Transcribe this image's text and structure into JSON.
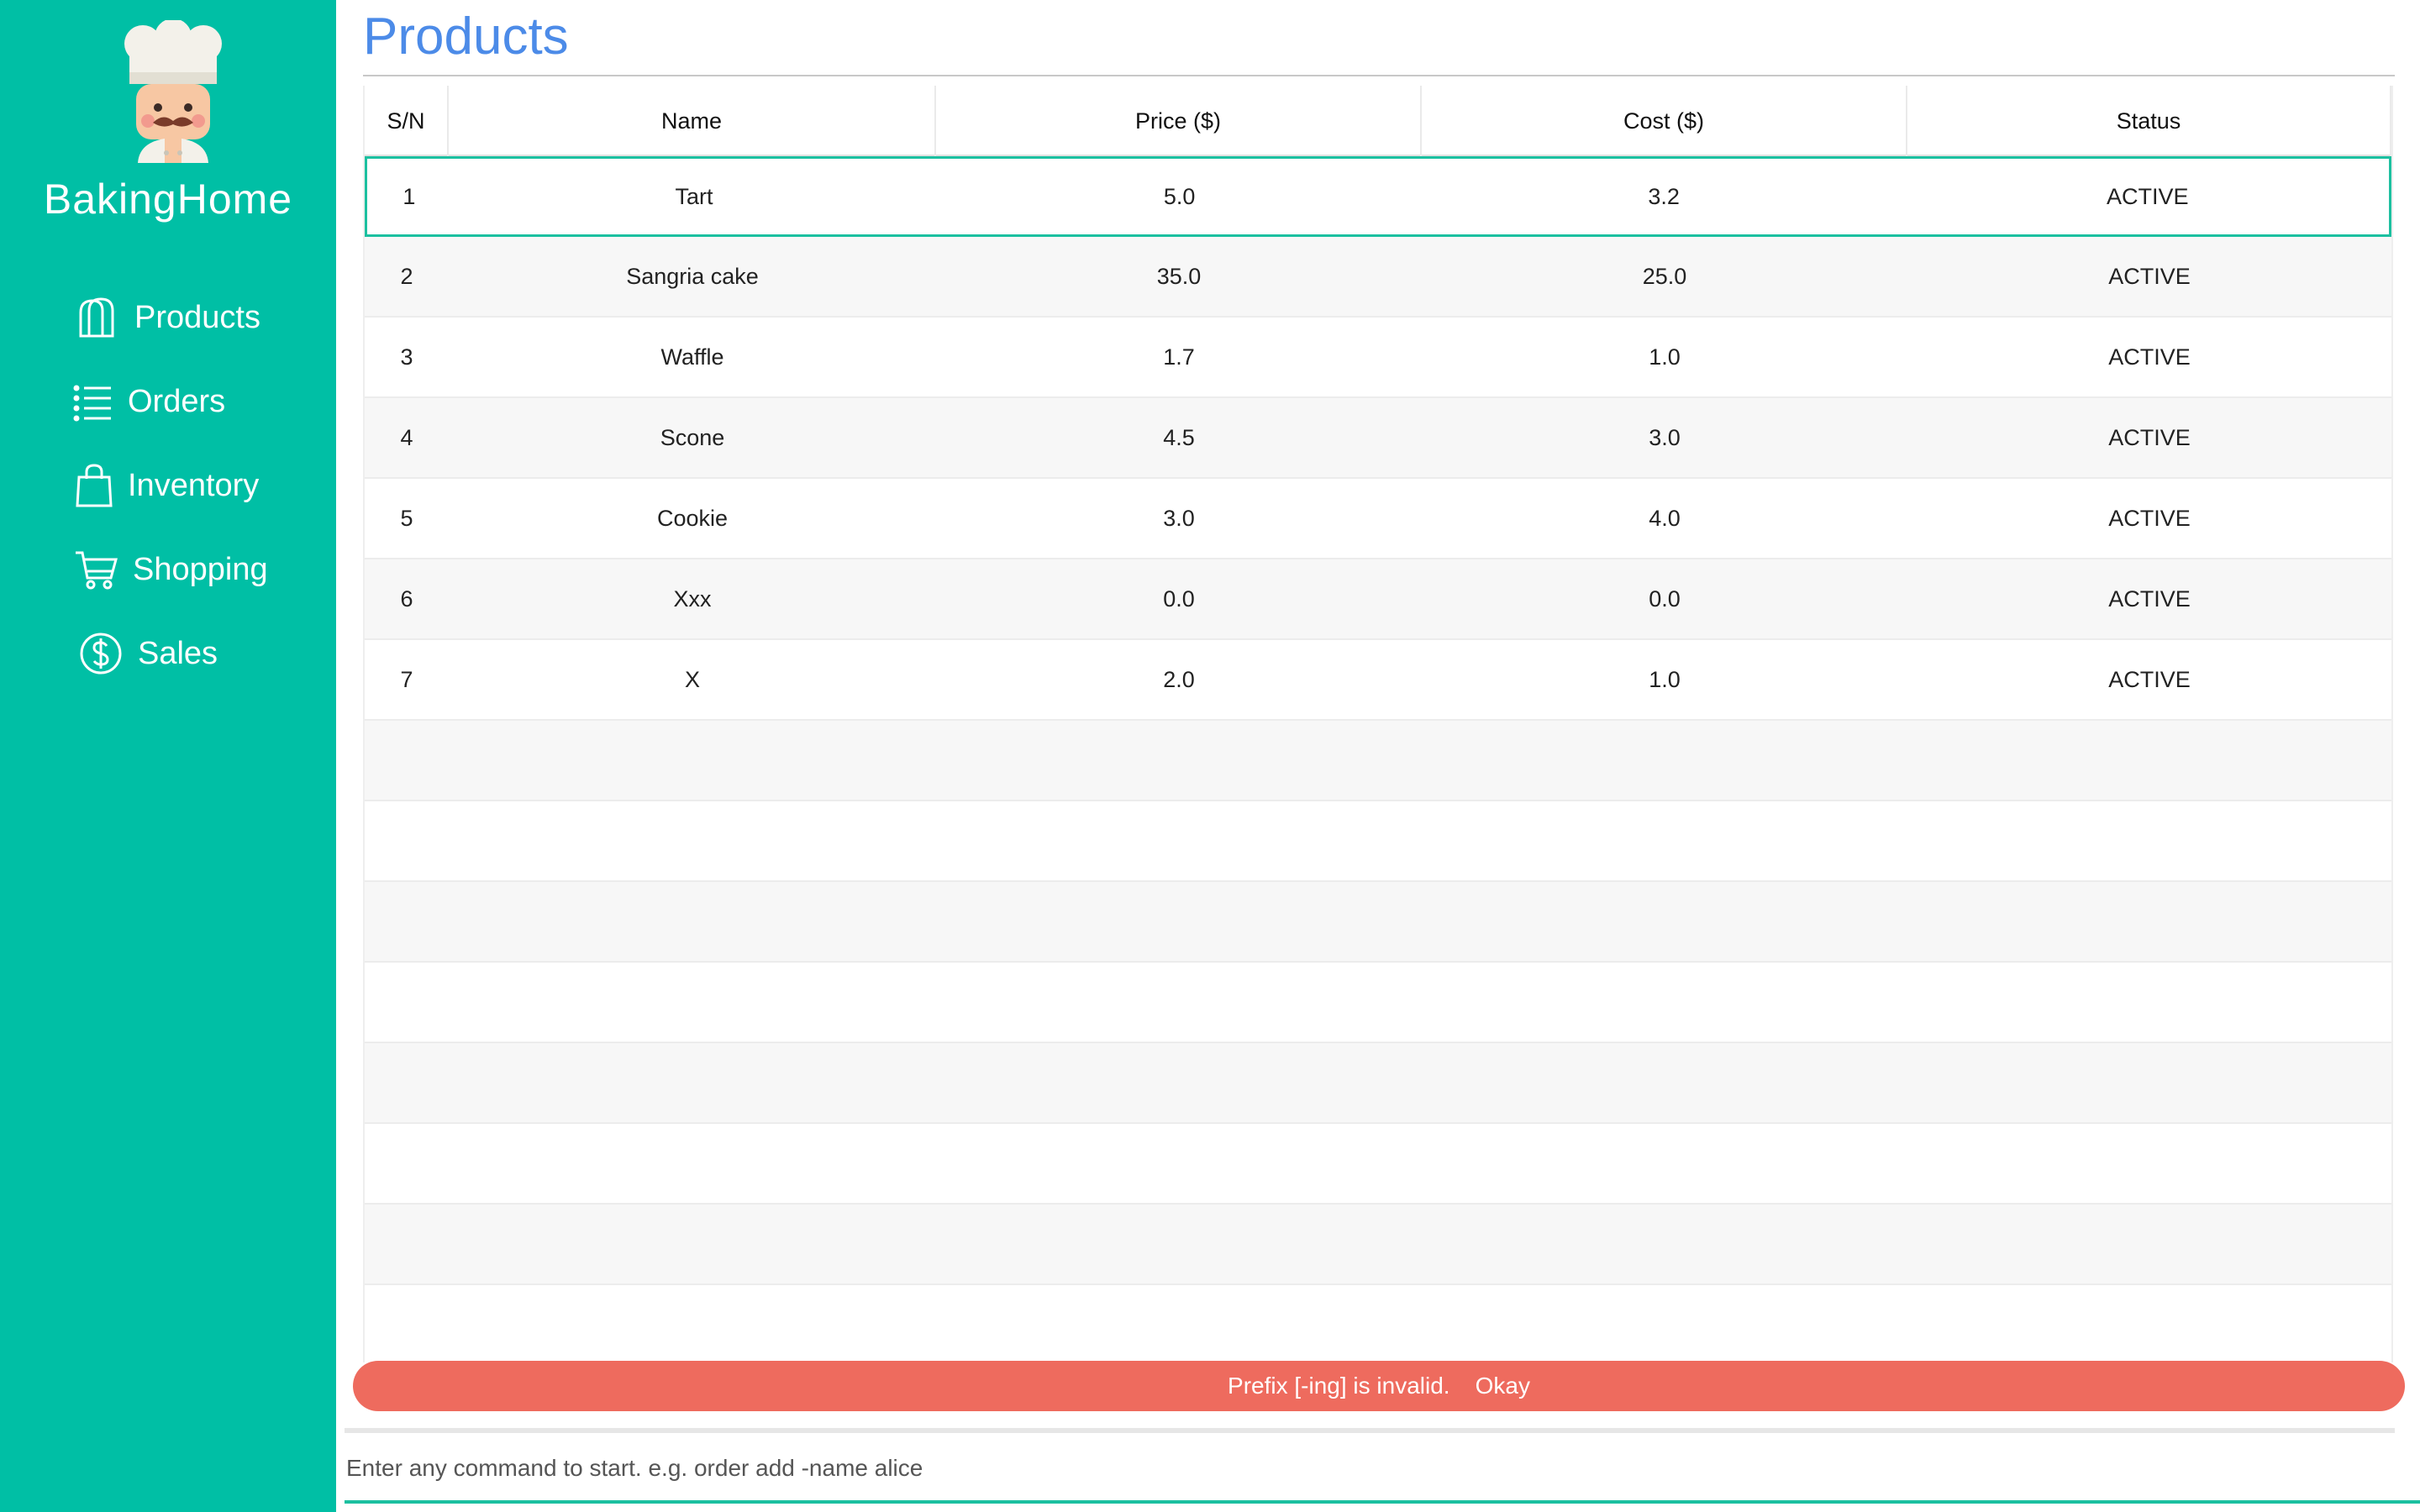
{
  "app": {
    "name": "BakingHome",
    "logo_icon": "chef-icon"
  },
  "sidebar": {
    "items": [
      {
        "label": "Products",
        "icon": "bread-icon"
      },
      {
        "label": "Orders",
        "icon": "list-icon"
      },
      {
        "label": "Inventory",
        "icon": "bag-icon"
      },
      {
        "label": "Shopping",
        "icon": "cart-icon"
      },
      {
        "label": "Sales",
        "icon": "dollar-icon"
      }
    ]
  },
  "main": {
    "title": "Products",
    "table": {
      "headers": [
        "S/N",
        "Name",
        "Price ($)",
        "Cost ($)",
        "Status"
      ],
      "rows": [
        [
          "1",
          "Tart",
          "5.0",
          "3.2",
          "ACTIVE"
        ],
        [
          "2",
          "Sangria cake",
          "35.0",
          "25.0",
          "ACTIVE"
        ],
        [
          "3",
          "Waffle",
          "1.7",
          "1.0",
          "ACTIVE"
        ],
        [
          "4",
          "Scone",
          "4.5",
          "3.0",
          "ACTIVE"
        ],
        [
          "5",
          "Cookie",
          "3.0",
          "4.0",
          "ACTIVE"
        ],
        [
          "6",
          "Xxx",
          "0.0",
          "0.0",
          "ACTIVE"
        ],
        [
          "7",
          "X",
          "2.0",
          "1.0",
          "ACTIVE"
        ]
      ]
    }
  },
  "toast": {
    "message": "Prefix [-ing] is invalid.",
    "action": "Okay"
  },
  "command": {
    "placeholder": "Enter any command to start. e.g. order add -name alice",
    "value": ""
  },
  "colors": {
    "sidebar": "#00bfa5",
    "title": "#4c8be8",
    "toast": "#ee6b5e",
    "accent": "#1cc0a0"
  }
}
